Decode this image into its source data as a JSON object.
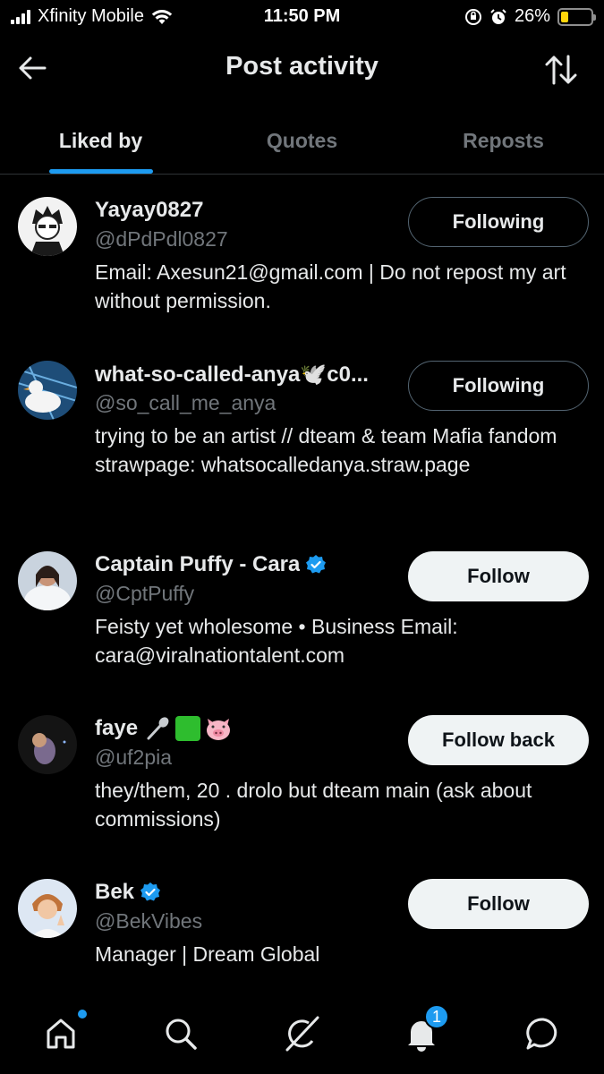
{
  "status_bar": {
    "carrier": "Xfinity Mobile",
    "time": "11:50 PM",
    "battery_percent": "26%",
    "battery_level": 0.26,
    "battery_color": "#ffd60a"
  },
  "header": {
    "title": "Post activity",
    "back_icon": "arrow-left-icon",
    "sort_icon": "sort-arrows-icon"
  },
  "tabs": [
    {
      "label": "Liked by",
      "active": true
    },
    {
      "label": "Quotes",
      "active": false
    },
    {
      "label": "Reposts",
      "active": false
    }
  ],
  "accent_color": "#1d9bf0",
  "users": [
    {
      "name": "Yayay0827",
      "handle": "@dPdPdl0827",
      "bio": "Email: Axesun21@gmail.com | Do not repost my art without permission.",
      "button": "Following",
      "verified": false
    },
    {
      "name": "what-so-called-anya🕊️c0...",
      "handle": "@so_call_me_anya",
      "bio": "trying to be an artist // dteam & team Mafia fandom\nstrawpage: whatsocalledanya.straw.page",
      "button": "Following",
      "verified": false
    },
    {
      "name": "Captain Puffy - Cara",
      "handle": "@CptPuffy",
      "bio": "Feisty yet wholesome • Business Email: cara@viralnationtalent.com",
      "button": "Follow",
      "verified": true
    },
    {
      "name": "faye",
      "handle": "@uf2pia",
      "bio": "they/them, 20 . drolo but dteam main (ask about commissions)",
      "button": "Follow back",
      "verified": false
    },
    {
      "name": "Bek",
      "handle": "@BekVibes",
      "bio": "Manager | Dream Global",
      "button": "Follow",
      "verified": true
    }
  ],
  "bottom_nav": {
    "items": [
      "home-icon",
      "search-icon",
      "grok-icon",
      "notifications-icon",
      "messages-icon"
    ],
    "notification_count": "1"
  }
}
